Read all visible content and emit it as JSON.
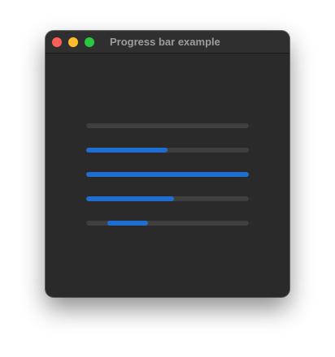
{
  "window": {
    "title": "Progress bar example"
  },
  "progress_bars": [
    {
      "id": "progress-bar-1",
      "value": 0.0
    },
    {
      "id": "progress-bar-2",
      "value": 0.5
    },
    {
      "id": "progress-bar-3",
      "value": 1.0
    },
    {
      "id": "progress-bar-4",
      "value": 0.54
    },
    {
      "id": "progress-bar-5",
      "indeterminate": true,
      "segment_start": 0.13,
      "segment_end": 0.38
    }
  ],
  "colors": {
    "window_background": "#2a2a2a",
    "track": "#3f3f3f",
    "accent": "#1e6ed2",
    "title_text": "#9d9d9d",
    "close": "#fe5f57",
    "minimize": "#febc2e",
    "zoom": "#28c840"
  }
}
